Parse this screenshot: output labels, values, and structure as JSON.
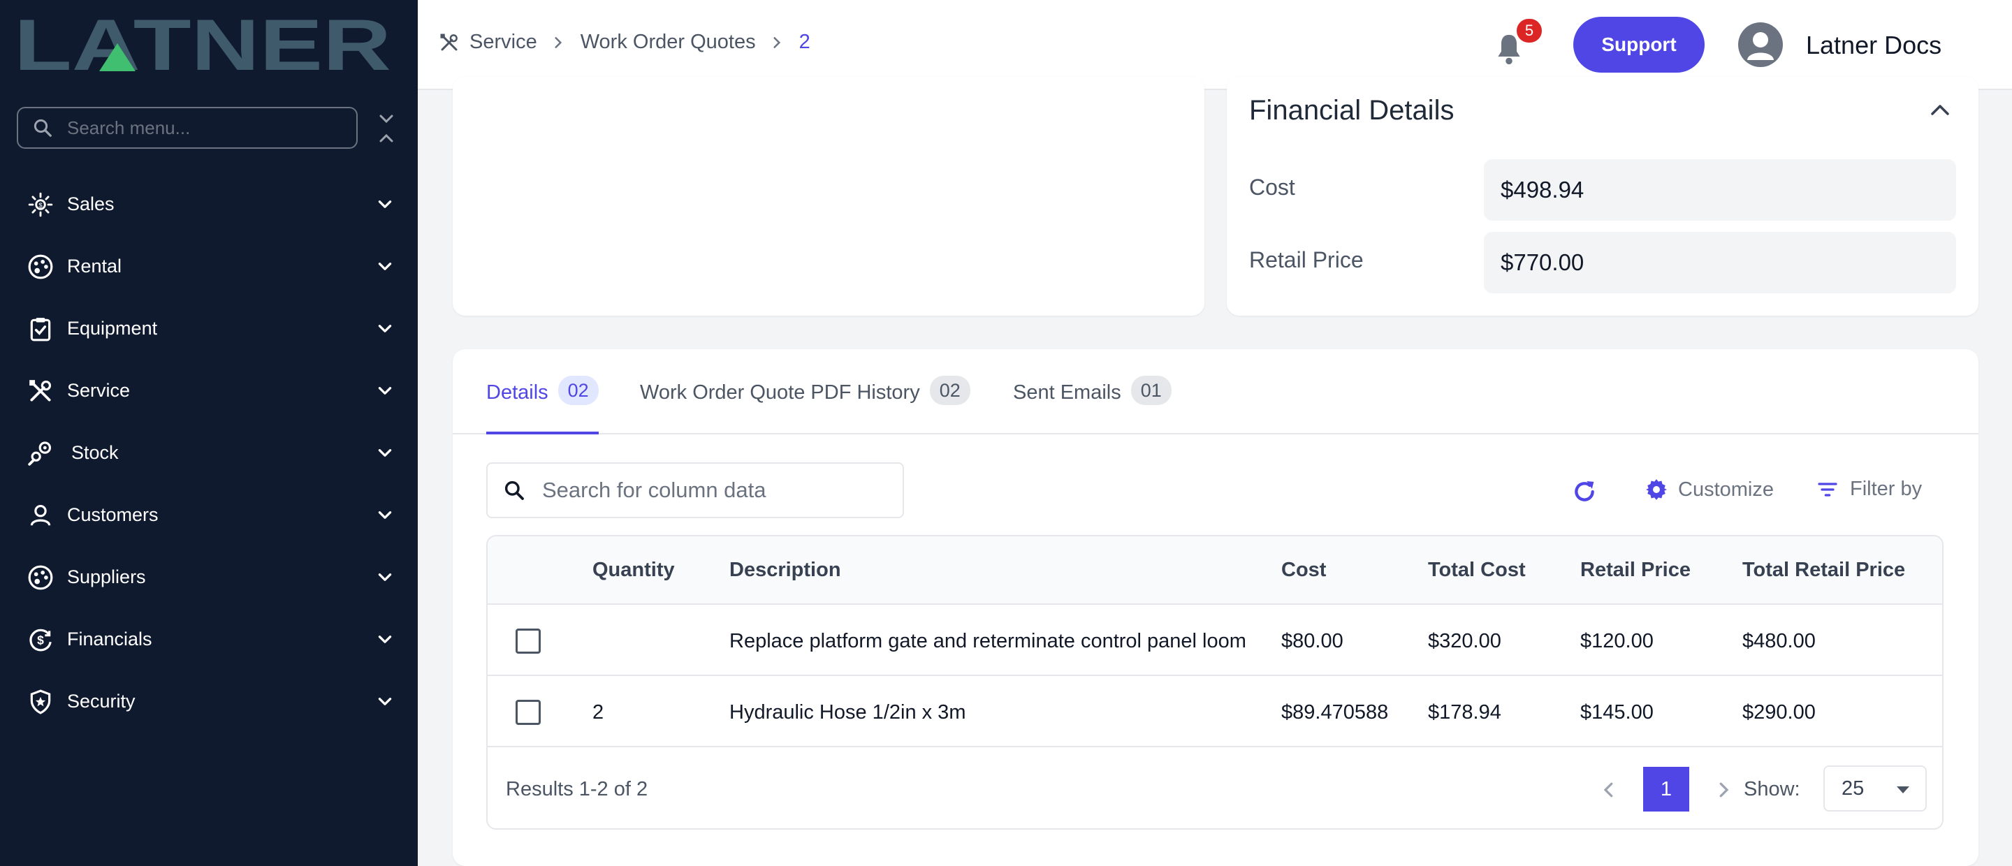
{
  "brand": {
    "logo_text": "LATNER"
  },
  "sidebar": {
    "search_placeholder": "Search menu...",
    "items": [
      {
        "label": "Sales",
        "icon": "sales-icon"
      },
      {
        "label": "Rental",
        "icon": "rental-icon"
      },
      {
        "label": "Equipment",
        "icon": "clipboard-check-icon"
      },
      {
        "label": "Service",
        "icon": "tools-icon"
      },
      {
        "label": "Stock",
        "icon": "gears-icon"
      },
      {
        "label": "Customers",
        "icon": "person-icon"
      },
      {
        "label": "Suppliers",
        "icon": "palette-icon"
      },
      {
        "label": "Financials",
        "icon": "dollar-cycle-icon"
      },
      {
        "label": "Security",
        "icon": "shield-star-icon"
      }
    ]
  },
  "header": {
    "breadcrumb": [
      "Service",
      "Work Order Quotes",
      "2"
    ],
    "notification_count": "5",
    "support_label": "Support",
    "user_name": "Latner Docs"
  },
  "financial": {
    "title": "Financial Details",
    "cost_label": "Cost",
    "cost_value": "$498.94",
    "retail_label": "Retail Price",
    "retail_value": "$770.00"
  },
  "tabs": [
    {
      "label": "Details",
      "count": "02",
      "active": true
    },
    {
      "label": "Work Order Quote PDF History",
      "count": "02",
      "active": false
    },
    {
      "label": "Sent Emails",
      "count": "01",
      "active": false
    }
  ],
  "toolbar": {
    "search_placeholder": "Search for column data",
    "customize_label": "Customize",
    "filter_label": "Filter by"
  },
  "table": {
    "columns": [
      "Quantity",
      "Description",
      "Cost",
      "Total Cost",
      "Retail Price",
      "Total Retail Price"
    ],
    "rows": [
      {
        "quantity": "",
        "description": "Replace platform gate and reterminate control panel loom",
        "cost": "$80.00",
        "total_cost": "$320.00",
        "retail_price": "$120.00",
        "total_retail_price": "$480.00"
      },
      {
        "quantity": "2",
        "description": "Hydraulic Hose 1/2in x 3m",
        "cost": "$89.470588",
        "total_cost": "$178.94",
        "retail_price": "$145.00",
        "total_retail_price": "$290.00"
      }
    ]
  },
  "pagination": {
    "results_text": "Results 1-2 of 2",
    "current_page": "1",
    "show_label": "Show:",
    "page_size": "25"
  },
  "colors": {
    "sidebar_bg": "#101a2e",
    "accent": "#4f46e5",
    "logo": "#3f5a6b",
    "logo_triangle": "#3fbf6f",
    "badge": "#dc2626"
  }
}
